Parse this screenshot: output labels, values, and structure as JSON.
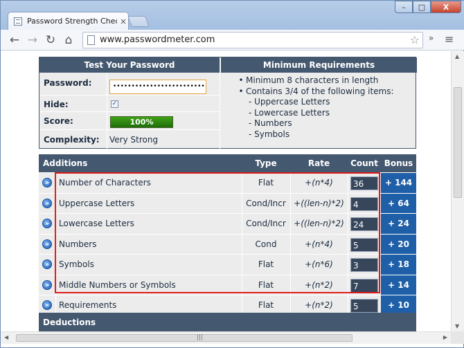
{
  "browser": {
    "tab_title": "Password Strength Checker",
    "tab_close": "×",
    "url": "www.passwordmeter.com",
    "back_icon": "arrow-left",
    "forward_icon": "arrow-right",
    "reload_icon": "reload",
    "home_icon": "home",
    "minimize": "–",
    "maximize": "□",
    "close": "X"
  },
  "test": {
    "header": "Test Your Password",
    "password_label": "Password:",
    "password_value": "••••••••••••••••••••••••••••••••••••",
    "hide_label": "Hide:",
    "hide_checked": "✓",
    "score_label": "Score:",
    "score_value": "100%",
    "complexity_label": "Complexity:",
    "complexity_value": "Very Strong"
  },
  "requirements": {
    "header": "Minimum Requirements",
    "items": [
      "Minimum 8 characters in length",
      "Contains 3/4 of the following items:"
    ],
    "subitems": [
      "- Uppercase Letters",
      "- Lowercase Letters",
      "- Numbers",
      "- Symbols"
    ]
  },
  "additions": {
    "headers": {
      "name": "Additions",
      "type": "Type",
      "rate": "Rate",
      "count": "Count",
      "bonus": "Bonus"
    },
    "rows": [
      {
        "name": "Number of Characters",
        "type": "Flat",
        "rate": "+(n*4)",
        "count": "36",
        "bonus": "+ 144"
      },
      {
        "name": "Uppercase Letters",
        "type": "Cond/Incr",
        "rate": "+((len-n)*2)",
        "count": "4",
        "bonus": "+ 64"
      },
      {
        "name": "Lowercase Letters",
        "type": "Cond/Incr",
        "rate": "+((len-n)*2)",
        "count": "24",
        "bonus": "+ 24"
      },
      {
        "name": "Numbers",
        "type": "Cond",
        "rate": "+(n*4)",
        "count": "5",
        "bonus": "+ 20"
      },
      {
        "name": "Symbols",
        "type": "Flat",
        "rate": "+(n*6)",
        "count": "3",
        "bonus": "+ 18"
      },
      {
        "name": "Middle Numbers or Symbols",
        "type": "Flat",
        "rate": "+(n*2)",
        "count": "7",
        "bonus": "+ 14"
      },
      {
        "name": "Requirements",
        "type": "Flat",
        "rate": "+(n*2)",
        "count": "5",
        "bonus": "+ 10"
      }
    ]
  },
  "deductions": {
    "header": "Deductions"
  },
  "colors": {
    "header": "#44586f",
    "bonus": "#1f5fa8",
    "highlight": "#e01b1b",
    "score": "#2f8a12"
  }
}
